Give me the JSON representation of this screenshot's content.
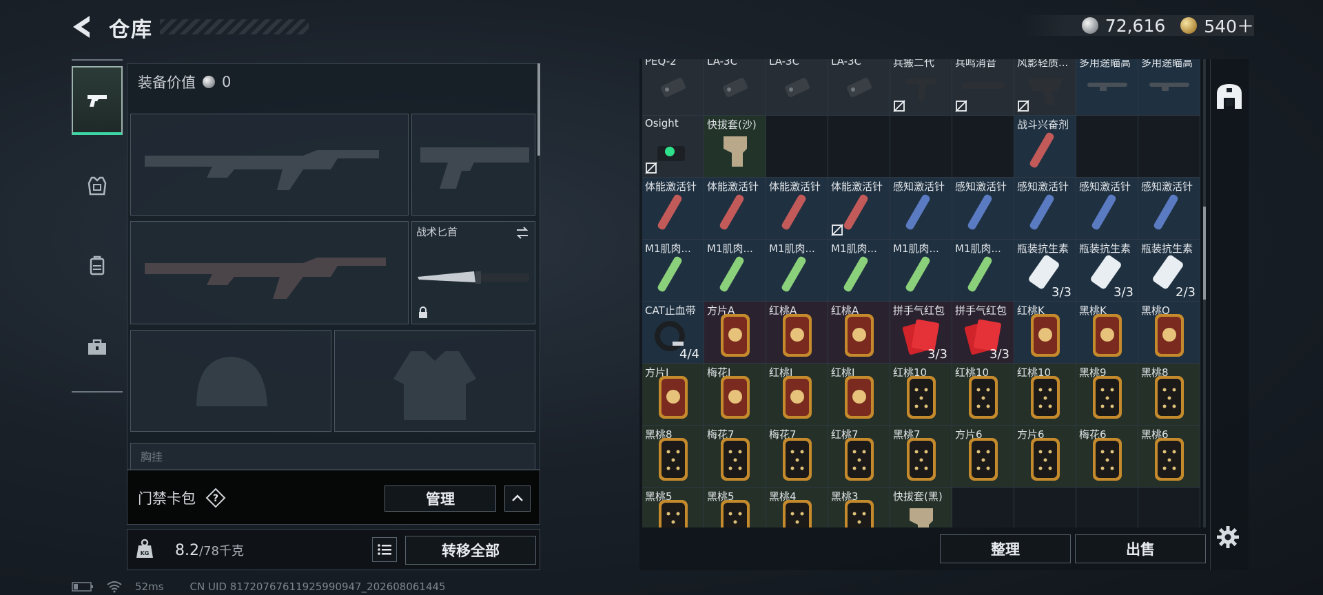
{
  "header": {
    "title": "仓库",
    "currency_silver": "72,616",
    "currency_gold": "540＋"
  },
  "loadout": {
    "equip_value_label": "装备价值",
    "equip_value": "0",
    "melee_slot_label": "战术匕首",
    "partial_section_label": "胸挂",
    "card_pack_label": "门禁卡包",
    "manage_label": "管理",
    "weight_current": "8.2",
    "weight_max": "/78千克",
    "transfer_all_label": "转移全部"
  },
  "status_bar": {
    "ping": "52ms",
    "uid": "CN UID 817207676119259909­47_202608061445"
  },
  "inventory": {
    "sort_label": "整理",
    "sell_label": "出售",
    "items": [
      {
        "name": "PEQ-2",
        "kind": "attach",
        "icon": "laser-icon"
      },
      {
        "name": "LA-3C",
        "kind": "attach",
        "icon": "laser-icon"
      },
      {
        "name": "LA-3C",
        "kind": "attach",
        "icon": "laser-icon"
      },
      {
        "name": "LA-3C",
        "kind": "attach",
        "icon": "laser-icon"
      },
      {
        "name": "兵搬二代",
        "kind": "attach",
        "icon": "grip-icon",
        "locked": true
      },
      {
        "name": "兵鸣消音",
        "kind": "attach",
        "icon": "suppressor-icon",
        "locked": true
      },
      {
        "name": "风影轻质...",
        "kind": "attach",
        "icon": "handguard-icon",
        "locked": true
      },
      {
        "name": "多用途瞄高",
        "kind": "med",
        "icon": "rail-icon"
      },
      {
        "name": "多用途瞄高",
        "kind": "med",
        "icon": "rail-icon"
      },
      {
        "name": "Osight",
        "kind": "attach",
        "icon": "sight-icon",
        "locked": true
      },
      {
        "name": "快拔套(沙)",
        "kind": "gear",
        "icon": "holster-icon"
      },
      {
        "name": "",
        "kind": "empty"
      },
      {
        "name": "",
        "kind": "empty"
      },
      {
        "name": "",
        "kind": "empty"
      },
      {
        "name": "",
        "kind": "empty"
      },
      {
        "name": "战斗兴奋剂",
        "kind": "med",
        "icon": "injector-red-icon"
      },
      {
        "name": "",
        "kind": "empty"
      },
      {
        "name": "",
        "kind": "empty"
      },
      {
        "name": "体能激活针",
        "kind": "med",
        "icon": "injector-red-icon"
      },
      {
        "name": "体能激活针",
        "kind": "med",
        "icon": "injector-red-icon"
      },
      {
        "name": "体能激活针",
        "kind": "med",
        "icon": "injector-red-icon"
      },
      {
        "name": "体能激活针",
        "kind": "med",
        "icon": "injector-red-icon",
        "locked": true
      },
      {
        "name": "感知激活针",
        "kind": "med",
        "icon": "injector-blue-icon"
      },
      {
        "name": "感知激活针",
        "kind": "med",
        "icon": "injector-blue-icon"
      },
      {
        "name": "感知激活针",
        "kind": "med",
        "icon": "injector-blue-icon"
      },
      {
        "name": "感知激活针",
        "kind": "med",
        "icon": "injector-blue-icon"
      },
      {
        "name": "感知激活针",
        "kind": "med",
        "icon": "injector-blue-icon"
      },
      {
        "name": "M1肌肉...",
        "kind": "med",
        "icon": "injector-green-icon"
      },
      {
        "name": "M1肌肉...",
        "kind": "med",
        "icon": "injector-green-icon"
      },
      {
        "name": "M1肌肉...",
        "kind": "med",
        "icon": "injector-green-icon"
      },
      {
        "name": "M1肌肉...",
        "kind": "med",
        "icon": "injector-green-icon"
      },
      {
        "name": "M1肌肉...",
        "kind": "med",
        "icon": "injector-green-icon"
      },
      {
        "name": "M1肌肉...",
        "kind": "med",
        "icon": "injector-green-icon"
      },
      {
        "name": "瓶装抗生素",
        "kind": "med",
        "icon": "pill-bottle-icon",
        "count": "3/3"
      },
      {
        "name": "瓶装抗生素",
        "kind": "med",
        "icon": "pill-bottle-icon",
        "count": "3/3"
      },
      {
        "name": "瓶装抗生素",
        "kind": "med",
        "icon": "pill-bottle-icon",
        "count": "2/3"
      },
      {
        "name": "CAT止血带",
        "kind": "med",
        "icon": "tourniquet-icon",
        "count": "4/4"
      },
      {
        "name": "方片A",
        "kind": "red",
        "icon": "card-face-icon"
      },
      {
        "name": "红桃A",
        "kind": "red",
        "icon": "card-face-icon"
      },
      {
        "name": "红桃A",
        "kind": "red",
        "icon": "card-face-icon"
      },
      {
        "name": "拼手气红包",
        "kind": "red",
        "icon": "red-envelope-icon",
        "count": "3/3"
      },
      {
        "name": "拼手气红包",
        "kind": "red",
        "icon": "red-envelope-icon",
        "count": "3/3"
      },
      {
        "name": "红桃K",
        "kind": "med",
        "icon": "card-face-icon"
      },
      {
        "name": "黑桃K",
        "kind": "med",
        "icon": "card-face-icon"
      },
      {
        "name": "黑桃Q",
        "kind": "med",
        "icon": "card-face-icon"
      },
      {
        "name": "方片J",
        "kind": "gold",
        "icon": "card-face-icon"
      },
      {
        "name": "梅花J",
        "kind": "gold",
        "icon": "card-face-icon"
      },
      {
        "name": "红桃J",
        "kind": "gold",
        "icon": "card-face-icon"
      },
      {
        "name": "红桃J",
        "kind": "gold",
        "icon": "card-face-icon"
      },
      {
        "name": "红桃10",
        "kind": "gold",
        "icon": "card-pip-icon"
      },
      {
        "name": "红桃10",
        "kind": "gold",
        "icon": "card-pip-icon"
      },
      {
        "name": "红桃10",
        "kind": "gold",
        "icon": "card-pip-icon"
      },
      {
        "name": "黑桃9",
        "kind": "gold",
        "icon": "card-pip-icon"
      },
      {
        "name": "黑桃8",
        "kind": "gold",
        "icon": "card-pip-icon"
      },
      {
        "name": "黑桃8",
        "kind": "gold",
        "icon": "card-pip-icon"
      },
      {
        "name": "梅花7",
        "kind": "gold",
        "icon": "card-pip-icon"
      },
      {
        "name": "梅花7",
        "kind": "gold",
        "icon": "card-pip-icon"
      },
      {
        "name": "红桃7",
        "kind": "gold",
        "icon": "card-pip-icon"
      },
      {
        "name": "黑桃7",
        "kind": "gold",
        "icon": "card-pip-icon"
      },
      {
        "name": "方片6",
        "kind": "gold",
        "icon": "card-pip-icon"
      },
      {
        "name": "方片6",
        "kind": "gold",
        "icon": "card-pip-icon"
      },
      {
        "name": "梅花6",
        "kind": "gold",
        "icon": "card-pip-icon"
      },
      {
        "name": "黑桃6",
        "kind": "gold",
        "icon": "card-pip-icon"
      },
      {
        "name": "黑桃5",
        "kind": "gold",
        "icon": "card-pip-icon"
      },
      {
        "name": "黑桃5",
        "kind": "gold",
        "icon": "card-pip-icon"
      },
      {
        "name": "黑桃4",
        "kind": "gold",
        "icon": "card-pip-icon"
      },
      {
        "name": "黑桃3",
        "kind": "gold",
        "icon": "card-pip-icon"
      },
      {
        "name": "快拔套(黑)",
        "kind": "gold",
        "icon": "holster-icon"
      },
      {
        "name": "",
        "kind": "empty"
      },
      {
        "name": "",
        "kind": "empty"
      },
      {
        "name": "",
        "kind": "empty"
      },
      {
        "name": "",
        "kind": "empty"
      }
    ]
  },
  "colors": {
    "accent_green": "#3dd6a4",
    "panel_bg": "#161e26",
    "cell_border": "#2e3944"
  }
}
